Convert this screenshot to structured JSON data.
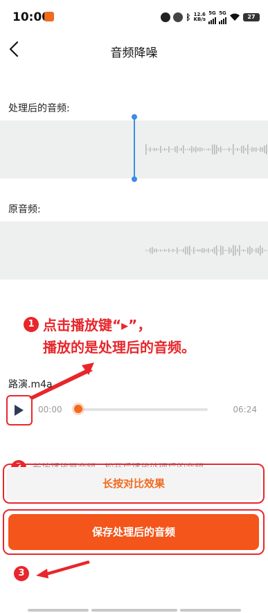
{
  "status_bar": {
    "time": "10:00",
    "network_speed_value": "12.6",
    "network_speed_unit": "KB/s",
    "sim1": "5G",
    "sim2": "5G",
    "battery": "27"
  },
  "header": {
    "title": "音频降噪"
  },
  "processed": {
    "label": "处理后的音频:"
  },
  "original": {
    "label": "原音频:"
  },
  "annotations": {
    "step1": "1",
    "step2": "2",
    "step3": "3",
    "instruction_line1": "点击播放键“▸”，",
    "instruction_line2": "播放的是处理后的音频。",
    "color": "#e8262b"
  },
  "player": {
    "file_name": "路演.m4a",
    "current_time": "00:00",
    "total_time": "06:24",
    "progress": 0
  },
  "hint": "长按播放原音频，松开后播放处理后的音频",
  "buttons": {
    "compare": "长按对比效果",
    "save": "保存处理后的音频"
  },
  "colors": {
    "accent": "#f26a1e",
    "playhead": "#3b8be8"
  }
}
